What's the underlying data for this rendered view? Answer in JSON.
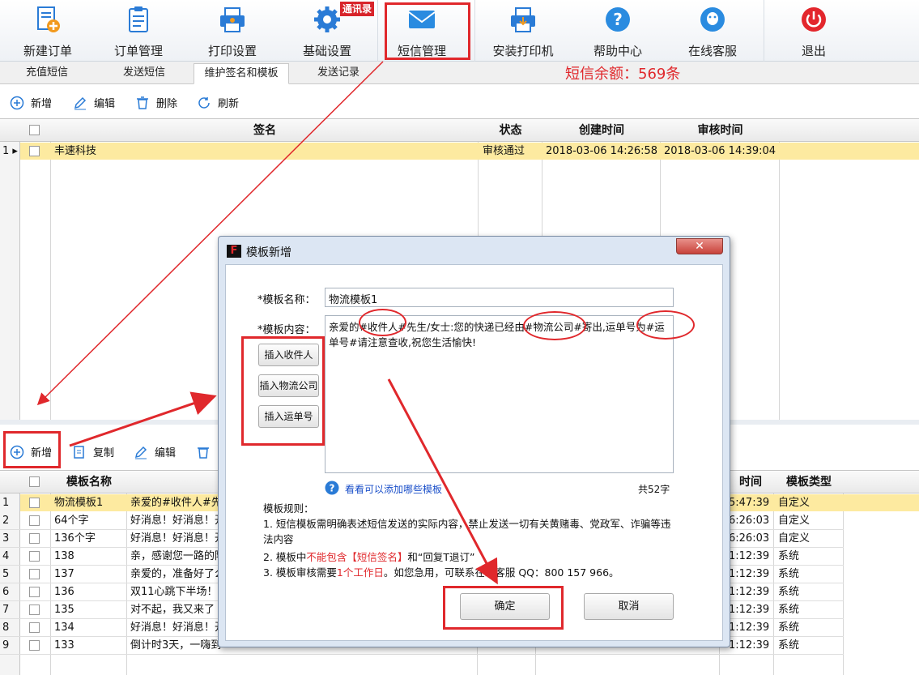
{
  "toolbar": {
    "items": [
      {
        "label": "新建订单",
        "icon": "new-order-icon"
      },
      {
        "label": "订单管理",
        "icon": "clipboard-icon"
      },
      {
        "label": "打印设置",
        "icon": "printer-settings-icon"
      },
      {
        "label": "基础设置",
        "icon": "gear-icon"
      },
      {
        "label": "短信管理",
        "icon": "envelope-icon"
      },
      {
        "label": "安装打印机",
        "icon": "printer-install-icon"
      },
      {
        "label": "帮助中心",
        "icon": "help-icon"
      },
      {
        "label": "在线客服",
        "icon": "customer-service-icon"
      },
      {
        "label": "退出",
        "icon": "power-icon"
      }
    ],
    "badge": "通讯录"
  },
  "tabs": [
    "充值短信",
    "发送短信",
    "维护签名和模板",
    "发送记录"
  ],
  "balance": "短信余额：569条",
  "sig_actions": [
    "新增",
    "编辑",
    "删除",
    "刷新"
  ],
  "sig_headers": [
    "签名",
    "状态",
    "创建时间",
    "审核时间"
  ],
  "sig_rows": [
    {
      "num": "1",
      "name": "丰速科技",
      "status": "审核通过",
      "created": "2018-03-06 14:26:58",
      "reviewed": "2018-03-06 14:39:04"
    }
  ],
  "tpl_actions": [
    "新增",
    "复制",
    "编辑"
  ],
  "tpl_headers": [
    "模板名称",
    "时间",
    "模板类型"
  ],
  "tpl_rows": [
    {
      "num": "1",
      "name": "物流模板1",
      "content": "亲爱的#收件人#先",
      "time": "5:47:39",
      "type": "自定义"
    },
    {
      "num": "2",
      "name": "64个字",
      "content": "好消息！好消息！开",
      "time": "6:26:03",
      "type": "自定义"
    },
    {
      "num": "3",
      "name": "136个字",
      "content": "好消息！好消息！开",
      "time": "6:26:03",
      "type": "自定义"
    },
    {
      "num": "4",
      "name": "138",
      "content": "亲，感谢您一路的陪",
      "time": "1:12:39",
      "type": "系统"
    },
    {
      "num": "5",
      "name": "137",
      "content": "亲爱的，准备好了么",
      "time": "1:12:39",
      "type": "系统"
    },
    {
      "num": "6",
      "name": "136",
      "content": "双11心跳下半场！",
      "time": "1:12:39",
      "type": "系统"
    },
    {
      "num": "7",
      "name": "135",
      "content": "对不起，我又来了",
      "time": "1:12:39",
      "type": "系统"
    },
    {
      "num": "8",
      "name": "134",
      "content": "好消息！好消息！开",
      "time": "1:12:39",
      "type": "系统"
    },
    {
      "num": "9",
      "name": "133",
      "content": "倒计时3天，一嗨到",
      "time": "1:12:39",
      "type": "系统"
    }
  ],
  "dialog": {
    "title": "模板新增",
    "name_label": "*模板名称：",
    "name_value": "物流模板1",
    "content_label": "*模板内容：",
    "content_value": "亲爱的#收件人#先生/女士:您的快递已经由#物流公司#寄出,运单号为#运单号#请注意查收,祝您生活愉快!",
    "insert_buttons": [
      "插入收件人",
      "插入物流公司",
      "插入运单号"
    ],
    "help_link": "看看可以添加哪些模板",
    "char_count": "共52字",
    "rules_title": "模板规则：",
    "rule1": "1. 短信模板需明确表述短信发送的实际内容，禁止发送一切有关黄赌毒、党政军、诈骗等违法内容",
    "rule2_a": "2. 模板中",
    "rule2_b": "不能包含【短信签名】",
    "rule2_c": "和“回复T退订”",
    "rule3_a": "3. 模板审核需要",
    "rule3_b": "1个工作日",
    "rule3_c": "。如您急用，可联系在线客服 QQ：800 157 966。",
    "ok": "确定",
    "cancel": "取消"
  },
  "colors": {
    "highlight": "#e0282c",
    "row_selected": "#fdeaa0",
    "accent": "#2a7bd6"
  }
}
